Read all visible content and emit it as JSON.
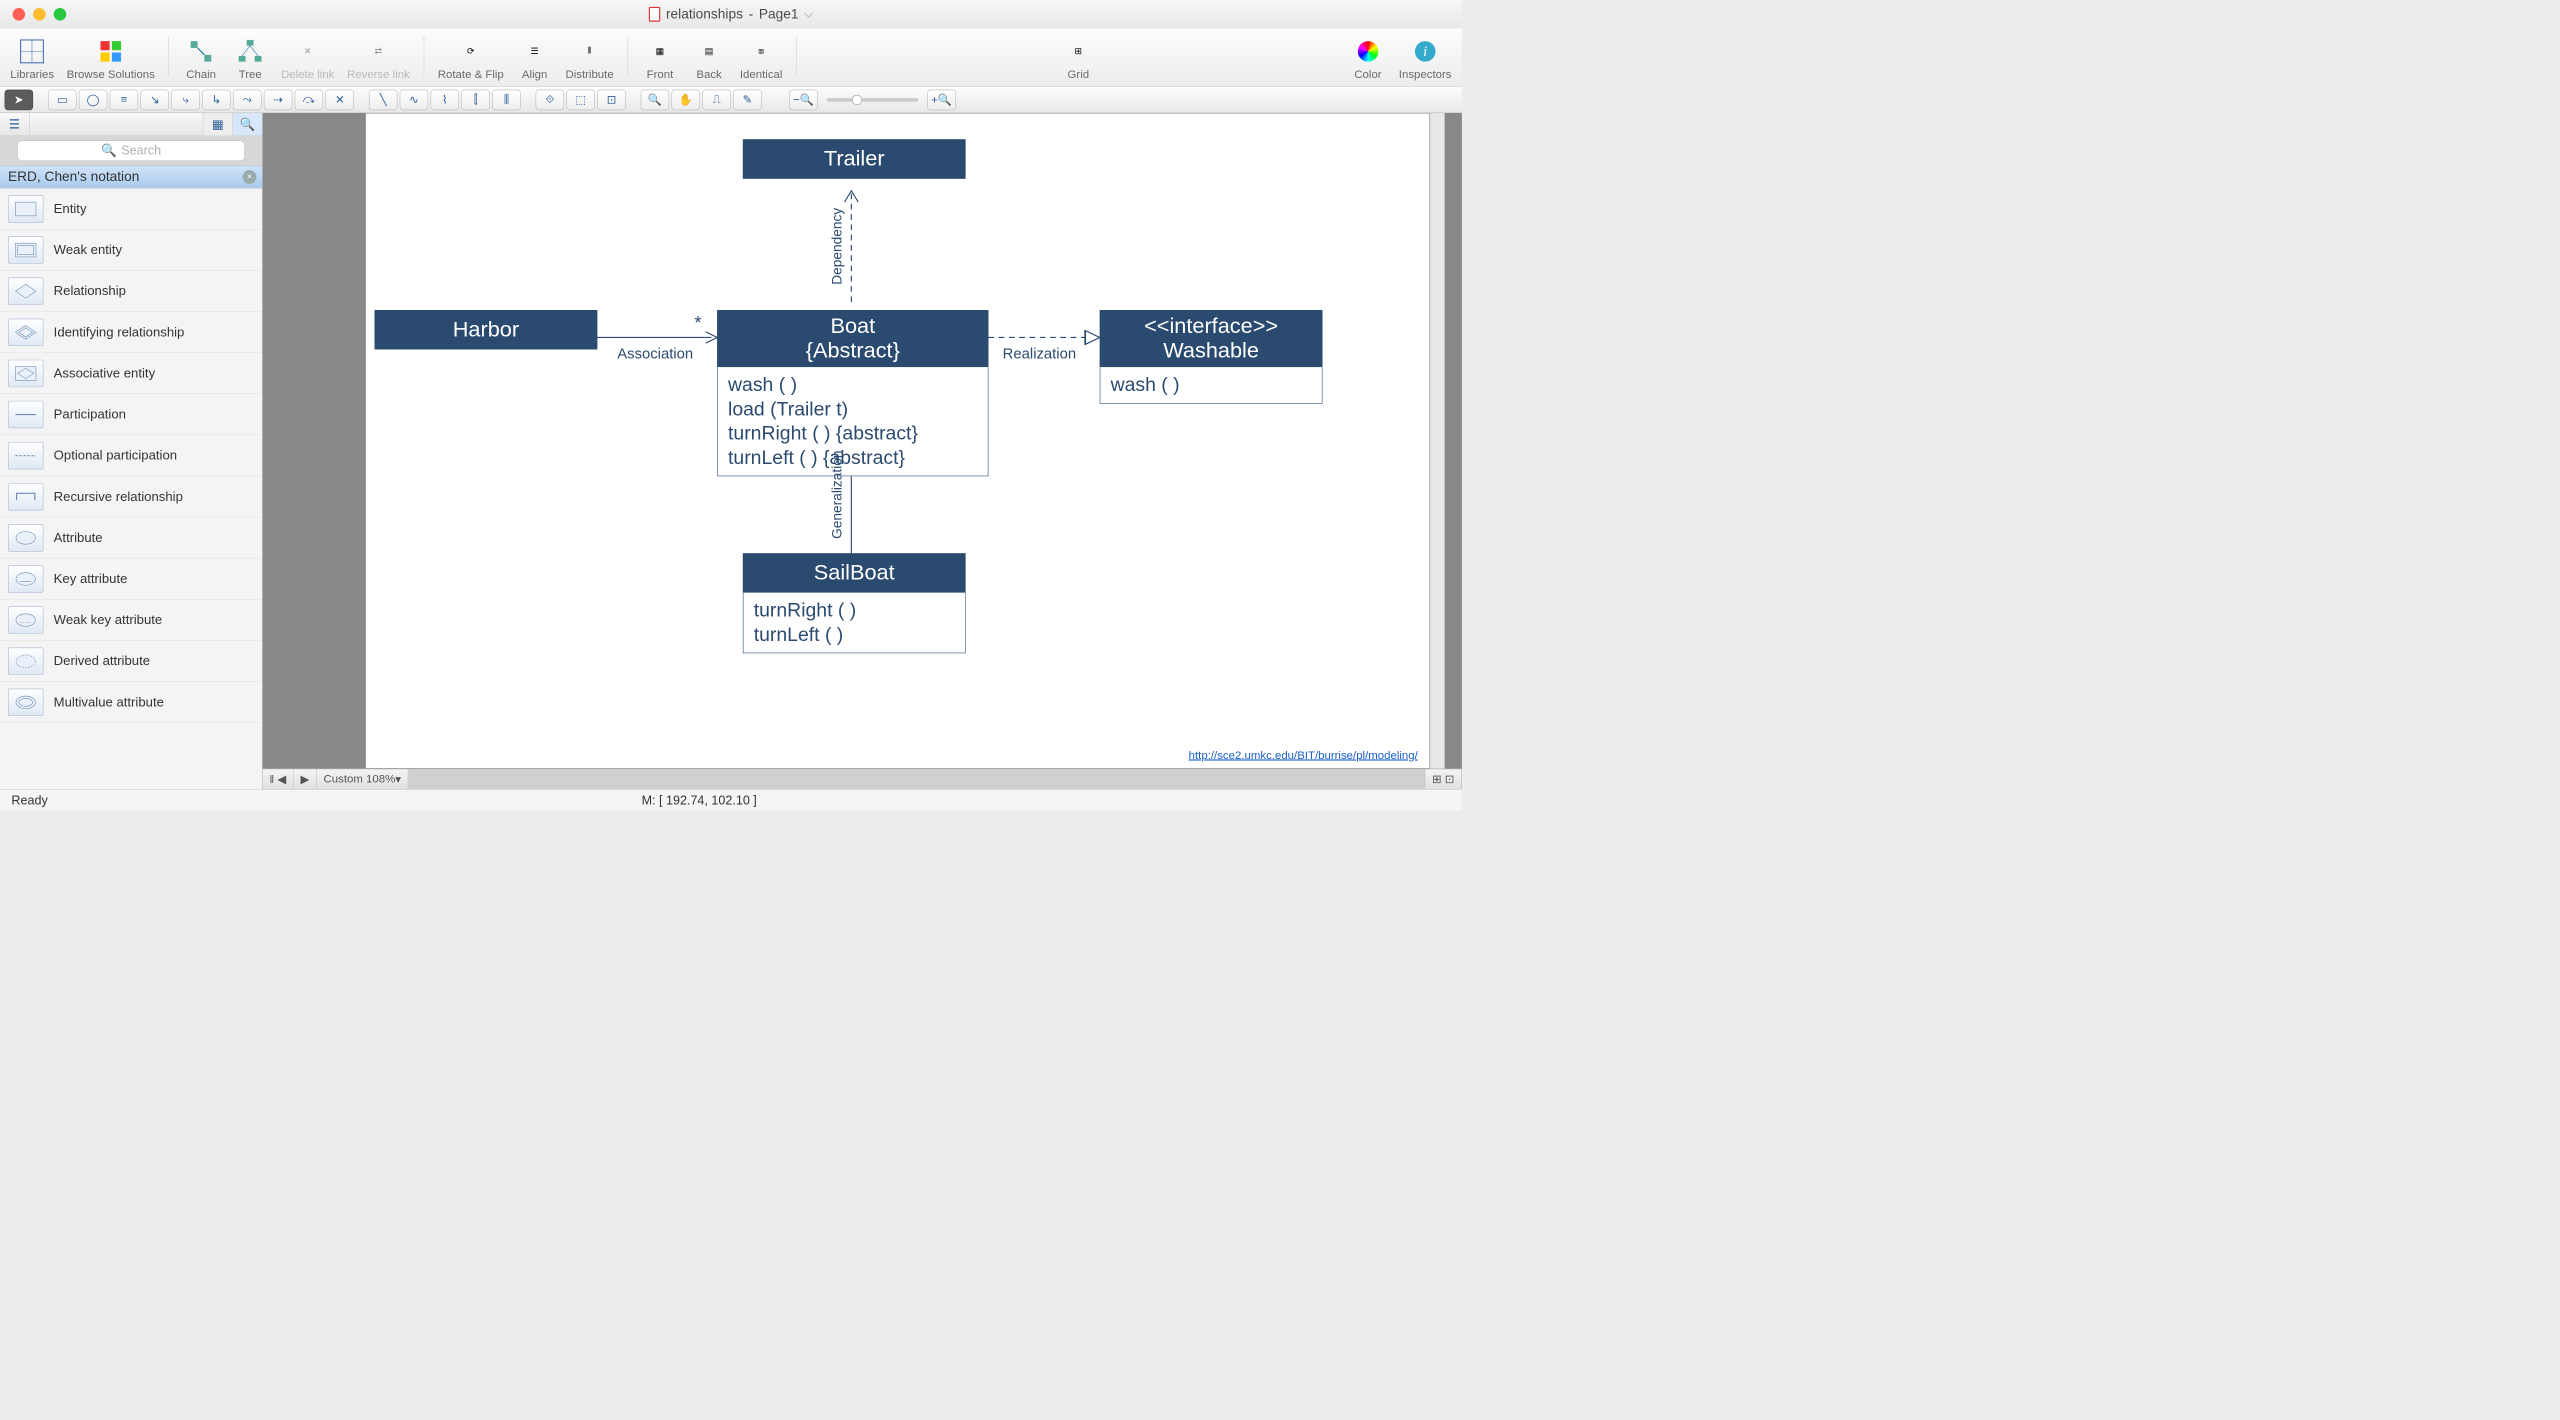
{
  "window": {
    "title_doc": "relationships",
    "title_page": "Page1"
  },
  "toolbar": {
    "libraries": "Libraries",
    "browse": "Browse Solutions",
    "chain": "Chain",
    "tree": "Tree",
    "delete_link": "Delete link",
    "reverse_link": "Reverse link",
    "rotate_flip": "Rotate & Flip",
    "align": "Align",
    "distribute": "Distribute",
    "front": "Front",
    "back": "Back",
    "identical": "Identical",
    "grid": "Grid",
    "color": "Color",
    "inspectors": "Inspectors"
  },
  "sidebar": {
    "search_placeholder": "Search",
    "library_header": "ERD, Chen's notation",
    "items": [
      "Entity",
      "Weak entity",
      "Relationship",
      "Identifying relationship",
      "Associative entity",
      "Participation",
      "Optional participation",
      "Recursive relationship",
      "Attribute",
      "Key attribute",
      "Weak key attribute",
      "Derived attribute",
      "Multivalue attribute"
    ]
  },
  "diagram": {
    "trailer": {
      "title": "Trailer"
    },
    "harbor": {
      "title": "Harbor"
    },
    "boat": {
      "title_line1": "Boat",
      "title_line2": "{Abstract}",
      "ops": [
        "wash ( )",
        "load (Trailer t)",
        "turnRight ( ) {abstract}",
        "turnLeft ( ) {abstract}"
      ]
    },
    "washable": {
      "stereo": "<<interface>>",
      "name": "Washable",
      "ops": [
        "wash ( )"
      ]
    },
    "sailboat": {
      "title": "SailBoat",
      "ops": [
        "turnRight ( )",
        "turnLeft ( )"
      ]
    },
    "labels": {
      "association": "Association",
      "star": "*",
      "dependency": "Dependency",
      "realization": "Realization",
      "generalization": "Generalization"
    },
    "hyperlink": "http://sce2.umkc.edu/BIT/burrise/pl/modeling/"
  },
  "pagebar": {
    "zoom_label": "Custom 108%"
  },
  "status": {
    "ready": "Ready",
    "mouse": "M: [ 192.74, 102.10 ]"
  }
}
